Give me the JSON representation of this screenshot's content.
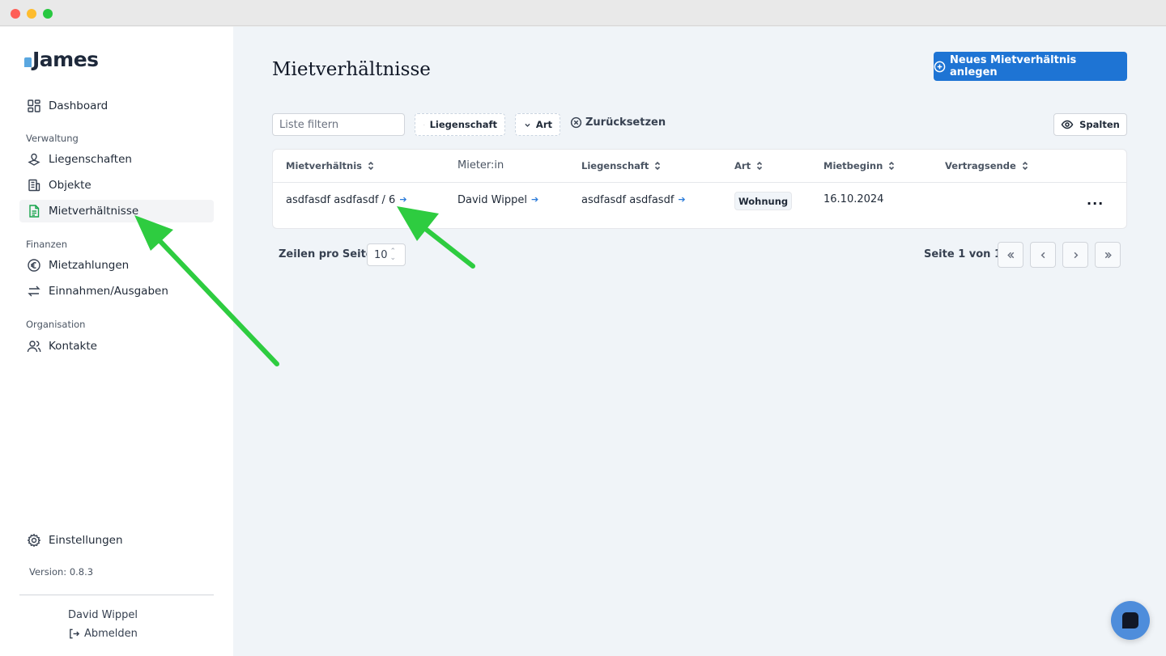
{
  "app": {
    "logo": "James",
    "version": "Version: 0.8.3"
  },
  "sidebar": {
    "dashboard": "Dashboard",
    "sections": {
      "verwaltung": "Verwaltung",
      "finanzen": "Finanzen",
      "organisation": "Organisation"
    },
    "items": {
      "liegenschaften": "Liegenschaften",
      "objekte": "Objekte",
      "mietverhaeltnisse": "Mietverhältnisse",
      "mietzahlungen": "Mietzahlungen",
      "einnahmen": "Einnahmen/Ausgaben",
      "kontakte": "Kontakte"
    },
    "settings": "Einstellungen",
    "user_name": "David Wippel",
    "logout": "Abmelden",
    "active_item": "Mietverhältnisse"
  },
  "page": {
    "title": "Mietverhältnisse",
    "primary_action": "Neues Mietverhältnis anlegen"
  },
  "filters": {
    "search_placeholder": "Liste filtern",
    "liegenschaft": "Liegenschaft",
    "art": "Art",
    "reset": "Zurücksetzen",
    "columns": "Spalten"
  },
  "table": {
    "headers": {
      "mietverhaeltnis": "Mietverhältnis",
      "mieter": "Mieter:in",
      "liegenschaft": "Liegenschaft",
      "art": "Art",
      "mietbeginn": "Mietbeginn",
      "vertragsende": "Vertragsende"
    },
    "rows": [
      {
        "mietverhaeltnis": "asdfasdf asdfasdf / 6",
        "mieter": "David Wippel",
        "liegenschaft": "asdfasdf asdfasdf",
        "art": "Wohnung",
        "mietbeginn": "16.10.2024",
        "vertragsende": "",
        "actions": "···"
      }
    ]
  },
  "pagination": {
    "rows_label": "Zeilen pro Seite",
    "rows_value": "10",
    "page_info": "Seite 1 von 1"
  },
  "colors": {
    "primary": "#1e74d4",
    "active_icon": "#16a34a",
    "link_arrow": "#2b7bd9",
    "annotation_arrow": "#2ecc40",
    "main_bg": "#f0f4f8"
  }
}
